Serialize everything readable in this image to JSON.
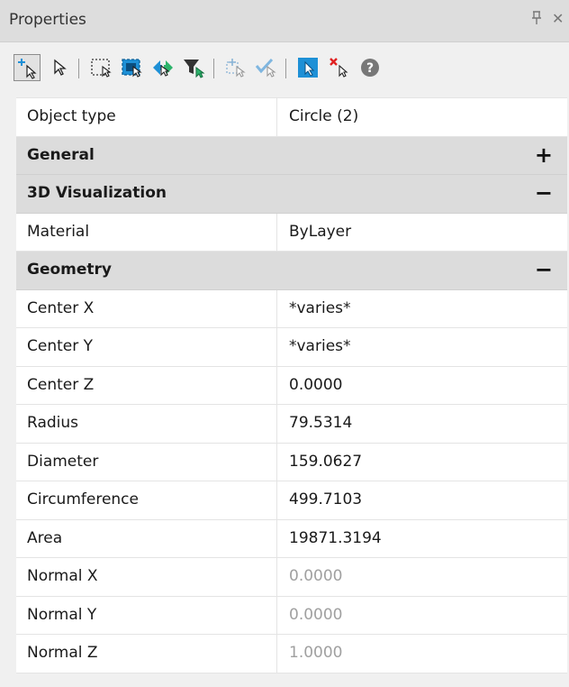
{
  "window": {
    "title": "Properties",
    "pin_glyph": "ᴘ",
    "close_glyph": "✕"
  },
  "toolbar": {
    "buttons": [
      {
        "name": "toggle-pickadd-icon",
        "pressed": true
      },
      {
        "name": "select-objects-icon",
        "pressed": false
      },
      {
        "name": "window-select-icon",
        "pressed": false
      },
      {
        "name": "crossing-select-icon",
        "pressed": false
      },
      {
        "name": "toggle-select-icon",
        "pressed": false
      },
      {
        "name": "filter-select-icon",
        "pressed": false
      },
      {
        "name": "select-similar-icon",
        "pressed": false
      },
      {
        "name": "quick-select-icon",
        "pressed": false
      },
      {
        "name": "select-mode-icon",
        "pressed": false
      },
      {
        "name": "deselect-icon",
        "pressed": false
      },
      {
        "name": "help-icon",
        "pressed": false
      }
    ]
  },
  "header_row": {
    "name": "Object type",
    "value": "Circle (2)"
  },
  "categories": {
    "general": {
      "label": "General",
      "toggle": "+"
    },
    "visualization": {
      "label": "3D Visualization",
      "toggle": "−"
    },
    "geometry": {
      "label": "Geometry",
      "toggle": "−"
    }
  },
  "visualization_rows": [
    {
      "name": "Material",
      "value": "ByLayer"
    }
  ],
  "geometry_rows": [
    {
      "name": "Center X",
      "value": "*varies*",
      "dim": false
    },
    {
      "name": "Center Y",
      "value": "*varies*",
      "dim": false
    },
    {
      "name": "Center Z",
      "value": "0.0000",
      "dim": false
    },
    {
      "name": "Radius",
      "value": "79.5314",
      "dim": false
    },
    {
      "name": "Diameter",
      "value": "159.0627",
      "dim": false
    },
    {
      "name": "Circumference",
      "value": "499.7103",
      "dim": false
    },
    {
      "name": "Area",
      "value": "19871.3194",
      "dim": false
    },
    {
      "name": "Normal X",
      "value": "0.0000",
      "dim": true
    },
    {
      "name": "Normal Y",
      "value": "0.0000",
      "dim": true
    },
    {
      "name": "Normal Z",
      "value": "1.0000",
      "dim": true
    }
  ],
  "colors": {
    "accent_blue": "#1e90d6",
    "toggle_red": "#e02020",
    "category_bg": "#dcdcdc",
    "dim_text": "#a0a0a0"
  }
}
